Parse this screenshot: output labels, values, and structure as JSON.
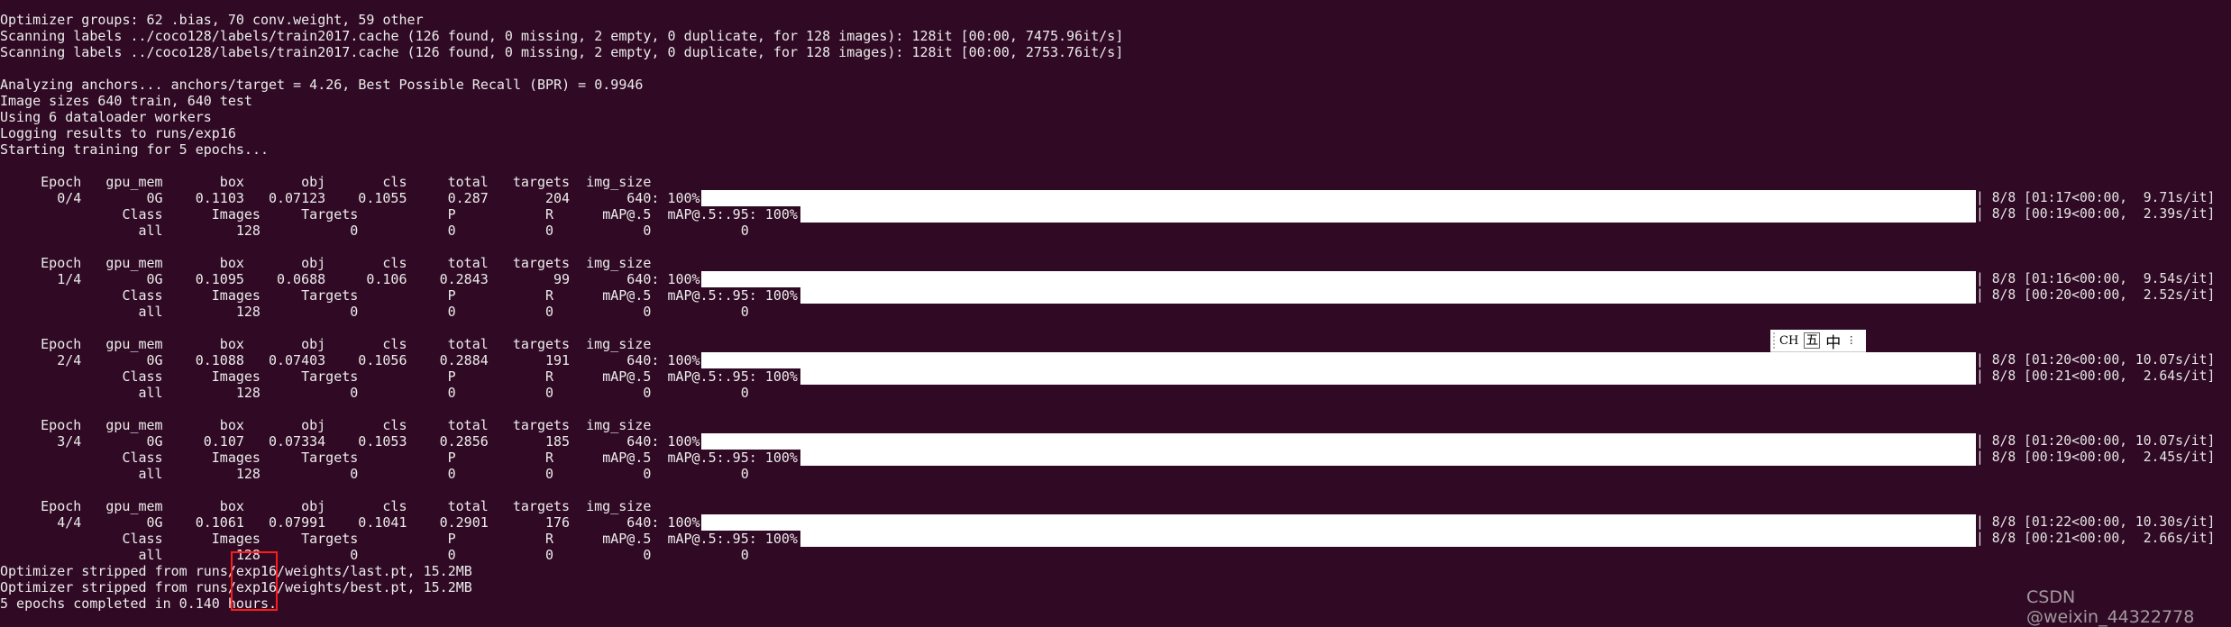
{
  "terminal": {
    "background": "#300a24",
    "intro_lines": [
      "Optimizer groups: 62 .bias, 70 conv.weight, 59 other",
      "Scanning labels ../coco128/labels/train2017.cache (126 found, 0 missing, 2 empty, 0 duplicate, for 128 images): 128it [00:00, 7475.96it/s]",
      "Scanning labels ../coco128/labels/train2017.cache (126 found, 0 missing, 2 empty, 0 duplicate, for 128 images): 128it [00:00, 2753.76it/s]",
      "",
      "Analyzing anchors... anchors/target = 4.26, Best Possible Recall (BPR) = 0.9946",
      "Image sizes 640 train, 640 test",
      "Using 6 dataloader workers",
      "Logging results to runs/exp16",
      "Starting training for 5 epochs..."
    ],
    "train_columns": [
      "Epoch",
      "gpu_mem",
      "box",
      "obj",
      "cls",
      "total",
      "targets",
      "img_size"
    ],
    "val_columns": [
      "Class",
      "Images",
      "Targets",
      "P",
      "R",
      "mAP@.5",
      "mAP@.5:.95"
    ],
    "progress_suffix": ": 100%|",
    "epochs": [
      {
        "cells": [
          "0/4",
          "0G",
          "0.1103",
          "0.07123",
          "0.1055",
          "0.287",
          "204",
          "640"
        ],
        "progress": 1.0,
        "train_progress": "8/8 [01:17<00:00,  9.71s/it]",
        "val_progress": "8/8 [00:19<00:00,  2.39s/it]",
        "val_cells": [
          "all",
          "128",
          "0",
          "0",
          "0",
          "0",
          "0"
        ]
      },
      {
        "cells": [
          "1/4",
          "0G",
          "0.1095",
          "0.0688",
          "0.106",
          "0.2843",
          "99",
          "640"
        ],
        "progress": 1.0,
        "train_progress": "8/8 [01:16<00:00,  9.54s/it]",
        "val_progress": "8/8 [00:20<00:00,  2.52s/it]",
        "val_cells": [
          "all",
          "128",
          "0",
          "0",
          "0",
          "0",
          "0"
        ]
      },
      {
        "cells": [
          "2/4",
          "0G",
          "0.1088",
          "0.07403",
          "0.1056",
          "0.2884",
          "191",
          "640"
        ],
        "progress": 1.0,
        "train_progress": "8/8 [01:20<00:00, 10.07s/it]",
        "val_progress": "8/8 [00:21<00:00,  2.64s/it]",
        "val_cells": [
          "all",
          "128",
          "0",
          "0",
          "0",
          "0",
          "0"
        ]
      },
      {
        "cells": [
          "3/4",
          "0G",
          "0.107",
          "0.07334",
          "0.1053",
          "0.2856",
          "185",
          "640"
        ],
        "progress": 1.0,
        "train_progress": "8/8 [01:20<00:00, 10.07s/it]",
        "val_progress": "8/8 [00:19<00:00,  2.45s/it]",
        "val_cells": [
          "all",
          "128",
          "0",
          "0",
          "0",
          "0",
          "0"
        ]
      },
      {
        "cells": [
          "4/4",
          "0G",
          "0.1061",
          "0.07991",
          "0.1041",
          "0.2901",
          "176",
          "640"
        ],
        "progress": 1.0,
        "train_progress": "8/8 [01:22<00:00, 10.30s/it]",
        "val_progress": "8/8 [00:21<00:00,  2.66s/it]",
        "val_cells": [
          "all",
          "128",
          "0",
          "0",
          "0",
          "0",
          "0"
        ]
      }
    ],
    "footer_lines": [
      "Optimizer stripped from runs/exp16/weights/last.pt, 15.2MB",
      "Optimizer stripped from runs/exp16/weights/best.pt, 15.2MB",
      "5 epochs completed in 0.140 hours."
    ]
  },
  "ime_toolbar": {
    "mode": "CH",
    "input_method": "五",
    "language": "中",
    "more": "⋮"
  },
  "highlight_color": "#ff1a1a",
  "watermark": "CSDN @weixin_44322778"
}
